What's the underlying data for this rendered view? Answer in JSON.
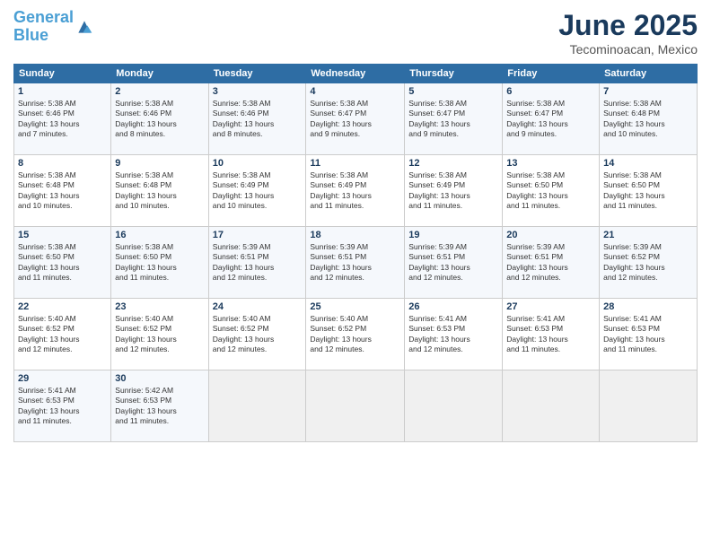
{
  "header": {
    "logo_line1": "General",
    "logo_line2": "Blue",
    "title": "June 2025",
    "subtitle": "Tecominoacan, Mexico"
  },
  "calendar": {
    "days_of_week": [
      "Sunday",
      "Monday",
      "Tuesday",
      "Wednesday",
      "Thursday",
      "Friday",
      "Saturday"
    ],
    "weeks": [
      [
        {
          "day": "",
          "info": ""
        },
        {
          "day": "2",
          "info": "Sunrise: 5:38 AM\nSunset: 6:46 PM\nDaylight: 13 hours\nand 8 minutes."
        },
        {
          "day": "3",
          "info": "Sunrise: 5:38 AM\nSunset: 6:46 PM\nDaylight: 13 hours\nand 8 minutes."
        },
        {
          "day": "4",
          "info": "Sunrise: 5:38 AM\nSunset: 6:47 PM\nDaylight: 13 hours\nand 9 minutes."
        },
        {
          "day": "5",
          "info": "Sunrise: 5:38 AM\nSunset: 6:47 PM\nDaylight: 13 hours\nand 9 minutes."
        },
        {
          "day": "6",
          "info": "Sunrise: 5:38 AM\nSunset: 6:47 PM\nDaylight: 13 hours\nand 9 minutes."
        },
        {
          "day": "7",
          "info": "Sunrise: 5:38 AM\nSunset: 6:48 PM\nDaylight: 13 hours\nand 10 minutes."
        }
      ],
      [
        {
          "day": "1",
          "info": "Sunrise: 5:38 AM\nSunset: 6:46 PM\nDaylight: 13 hours\nand 7 minutes."
        },
        null,
        null,
        null,
        null,
        null,
        null
      ],
      [
        {
          "day": "8",
          "info": "Sunrise: 5:38 AM\nSunset: 6:48 PM\nDaylight: 13 hours\nand 10 minutes."
        },
        {
          "day": "9",
          "info": "Sunrise: 5:38 AM\nSunset: 6:48 PM\nDaylight: 13 hours\nand 10 minutes."
        },
        {
          "day": "10",
          "info": "Sunrise: 5:38 AM\nSunset: 6:49 PM\nDaylight: 13 hours\nand 10 minutes."
        },
        {
          "day": "11",
          "info": "Sunrise: 5:38 AM\nSunset: 6:49 PM\nDaylight: 13 hours\nand 11 minutes."
        },
        {
          "day": "12",
          "info": "Sunrise: 5:38 AM\nSunset: 6:49 PM\nDaylight: 13 hours\nand 11 minutes."
        },
        {
          "day": "13",
          "info": "Sunrise: 5:38 AM\nSunset: 6:50 PM\nDaylight: 13 hours\nand 11 minutes."
        },
        {
          "day": "14",
          "info": "Sunrise: 5:38 AM\nSunset: 6:50 PM\nDaylight: 13 hours\nand 11 minutes."
        }
      ],
      [
        {
          "day": "15",
          "info": "Sunrise: 5:38 AM\nSunset: 6:50 PM\nDaylight: 13 hours\nand 11 minutes."
        },
        {
          "day": "16",
          "info": "Sunrise: 5:38 AM\nSunset: 6:50 PM\nDaylight: 13 hours\nand 11 minutes."
        },
        {
          "day": "17",
          "info": "Sunrise: 5:39 AM\nSunset: 6:51 PM\nDaylight: 13 hours\nand 12 minutes."
        },
        {
          "day": "18",
          "info": "Sunrise: 5:39 AM\nSunset: 6:51 PM\nDaylight: 13 hours\nand 12 minutes."
        },
        {
          "day": "19",
          "info": "Sunrise: 5:39 AM\nSunset: 6:51 PM\nDaylight: 13 hours\nand 12 minutes."
        },
        {
          "day": "20",
          "info": "Sunrise: 5:39 AM\nSunset: 6:51 PM\nDaylight: 13 hours\nand 12 minutes."
        },
        {
          "day": "21",
          "info": "Sunrise: 5:39 AM\nSunset: 6:52 PM\nDaylight: 13 hours\nand 12 minutes."
        }
      ],
      [
        {
          "day": "22",
          "info": "Sunrise: 5:40 AM\nSunset: 6:52 PM\nDaylight: 13 hours\nand 12 minutes."
        },
        {
          "day": "23",
          "info": "Sunrise: 5:40 AM\nSunset: 6:52 PM\nDaylight: 13 hours\nand 12 minutes."
        },
        {
          "day": "24",
          "info": "Sunrise: 5:40 AM\nSunset: 6:52 PM\nDaylight: 13 hours\nand 12 minutes."
        },
        {
          "day": "25",
          "info": "Sunrise: 5:40 AM\nSunset: 6:52 PM\nDaylight: 13 hours\nand 12 minutes."
        },
        {
          "day": "26",
          "info": "Sunrise: 5:41 AM\nSunset: 6:53 PM\nDaylight: 13 hours\nand 12 minutes."
        },
        {
          "day": "27",
          "info": "Sunrise: 5:41 AM\nSunset: 6:53 PM\nDaylight: 13 hours\nand 11 minutes."
        },
        {
          "day": "28",
          "info": "Sunrise: 5:41 AM\nSunset: 6:53 PM\nDaylight: 13 hours\nand 11 minutes."
        }
      ],
      [
        {
          "day": "29",
          "info": "Sunrise: 5:41 AM\nSunset: 6:53 PM\nDaylight: 13 hours\nand 11 minutes."
        },
        {
          "day": "30",
          "info": "Sunrise: 5:42 AM\nSunset: 6:53 PM\nDaylight: 13 hours\nand 11 minutes."
        },
        {
          "day": "",
          "info": ""
        },
        {
          "day": "",
          "info": ""
        },
        {
          "day": "",
          "info": ""
        },
        {
          "day": "",
          "info": ""
        },
        {
          "day": "",
          "info": ""
        }
      ]
    ]
  }
}
